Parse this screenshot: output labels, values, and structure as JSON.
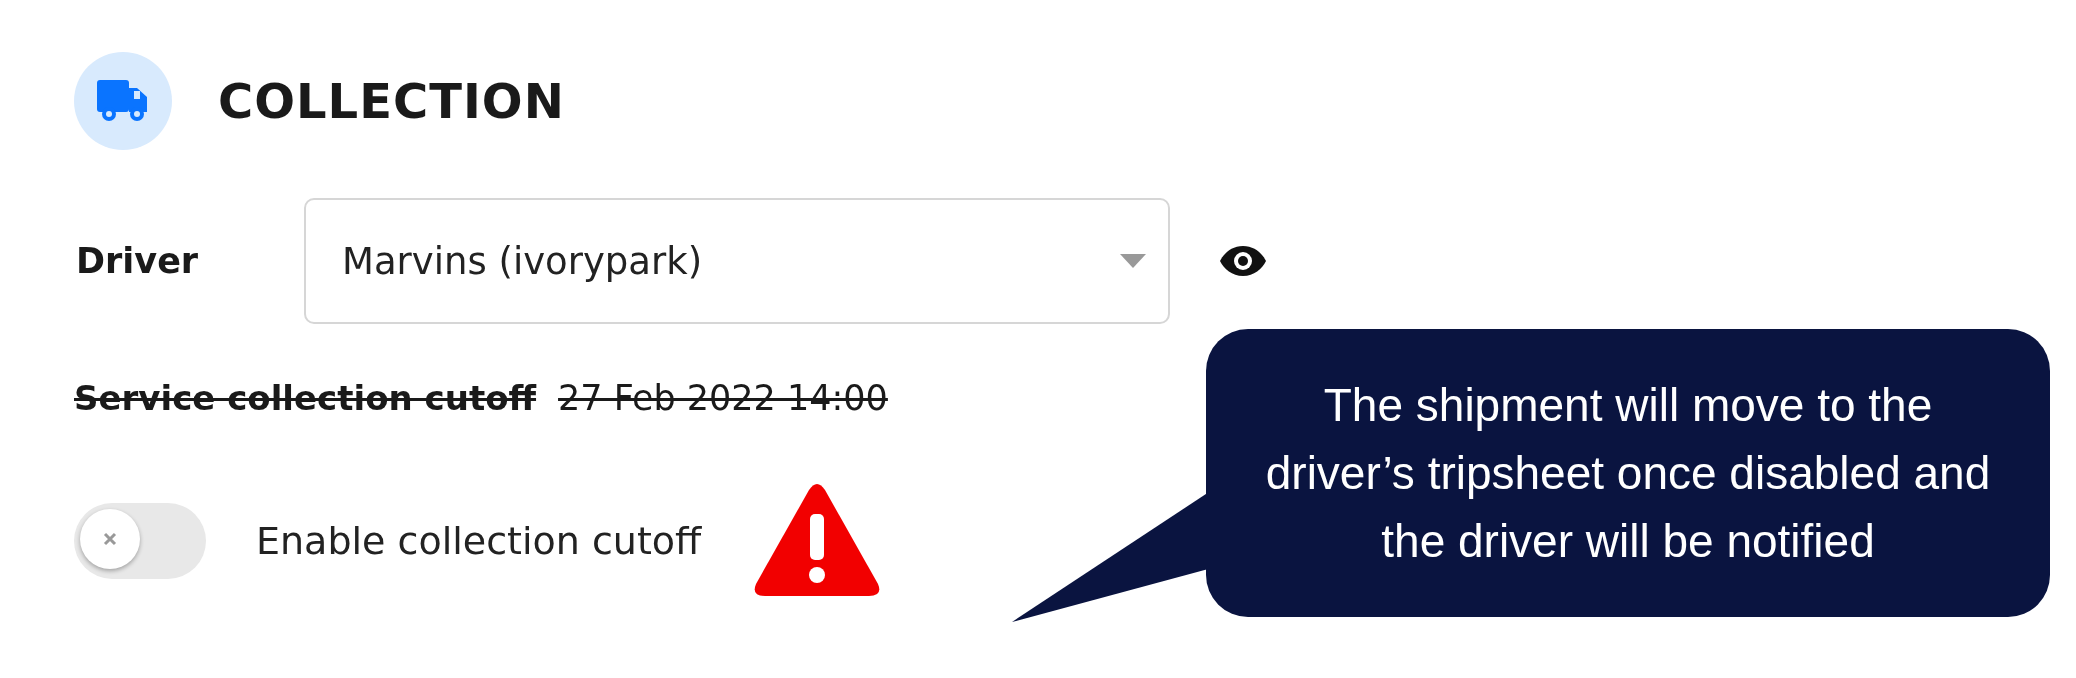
{
  "section": {
    "title": "COLLECTION"
  },
  "driver": {
    "label": "Driver",
    "value": "Marvins (ivorypark)"
  },
  "cutoff": {
    "label": "Service collection cutoff",
    "value": "27 Feb 2022 14:00",
    "strikethrough": true
  },
  "toggle": {
    "label": "Enable collection cutoff",
    "on": false
  },
  "callout": {
    "text": "The shipment will move to the driver’s tripsheet once disabled and the driver will be notified"
  }
}
